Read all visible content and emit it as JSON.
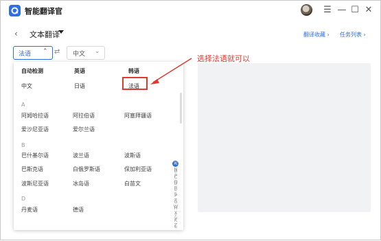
{
  "app": {
    "title": "智能翻译官"
  },
  "window_controls": {
    "menu": "☰",
    "minimize": "—",
    "maximize": "☐",
    "close": "✕"
  },
  "toolbar": {
    "back": "‹",
    "title": "文本翻译",
    "favorites_link": "翻译收藏 ›",
    "tasks_link": "任务列表 ›"
  },
  "source_select": {
    "value": "法语",
    "chevron": "⌃"
  },
  "swap_icon": "⇄",
  "target_select": {
    "value": "中文",
    "chevron": "⌄"
  },
  "quick_langs": {
    "row1": [
      "自动检测",
      "英语",
      "韩语"
    ],
    "row2": [
      "中文",
      "日语",
      "法语"
    ]
  },
  "sections": [
    {
      "letter": "A",
      "rows": [
        [
          "阿姆哈拉语",
          "阿拉伯语",
          "阿塞拜疆语"
        ],
        [
          "爱沙尼亚语",
          "爱尔兰语"
        ]
      ]
    },
    {
      "letter": "B",
      "rows": [
        [
          "巴什基尔语",
          "波兰语",
          "波斯语"
        ],
        [
          "巴斯克语",
          "白俄罗斯语",
          "保加利亚语"
        ],
        [
          "波斯尼亚语",
          "冰岛语",
          "白苗文"
        ]
      ]
    },
    {
      "letter": "D",
      "rows": [
        [
          "丹麦语",
          "德语"
        ]
      ]
    }
  ],
  "alphabet": [
    "A",
    "B",
    "C",
    "D",
    "E",
    "F",
    "G",
    "H",
    "J",
    "K",
    "L",
    "M",
    "N",
    "P",
    "Q",
    "R",
    "S",
    "T",
    "W",
    "X",
    "Y",
    "Z"
  ],
  "annotation": {
    "text": "选择法语就可以"
  },
  "colors": {
    "accent": "#2e6fe6",
    "annotation_red": "#e03a2f"
  }
}
